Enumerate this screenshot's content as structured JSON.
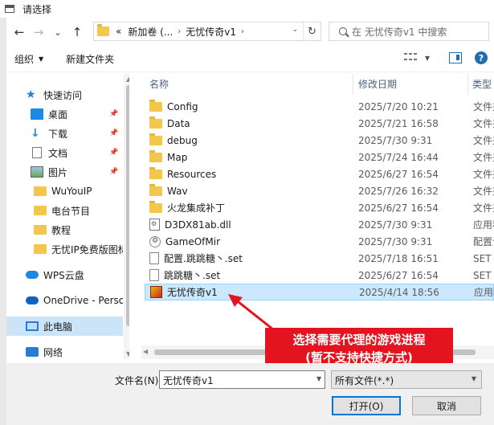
{
  "window": {
    "title": "请选择"
  },
  "nav": {
    "back_icon": "←",
    "forward_icon": "→",
    "dropdown_icon": "⌄",
    "up_icon": "↑",
    "breadcrumb": [
      "«",
      "新加卷 (...",
      "›",
      "无忧传奇v1",
      "›"
    ],
    "refresh_icon": "↻",
    "search_placeholder": "在 无忧传奇v1 中搜索"
  },
  "toolbar": {
    "organize_label": "组织",
    "organize_caret": "▼",
    "new_folder_label": "新建文件夹",
    "view_caret": "▼",
    "help_glyph": "?"
  },
  "sidebar": {
    "items": [
      {
        "label": "快速访问",
        "icon": "star-icon"
      },
      {
        "label": "桌面",
        "icon": "desktop-icon",
        "pin": "📌"
      },
      {
        "label": "下载",
        "icon": "download-icon",
        "pin": "📌"
      },
      {
        "label": "文档",
        "icon": "document-icon",
        "pin": "📌"
      },
      {
        "label": "图片",
        "icon": "pictures-icon",
        "pin": "📌"
      },
      {
        "label": "WuYouIP",
        "icon": "folder-icon"
      },
      {
        "label": "电台节目",
        "icon": "folder-icon"
      },
      {
        "label": "教程",
        "icon": "folder-icon"
      },
      {
        "label": "无忧IP免费版图标",
        "icon": "folder-icon"
      },
      {
        "label": "WPS云盘",
        "icon": "cloud-icon"
      },
      {
        "label": "OneDrive - Personal",
        "icon": "onedrive-icon"
      },
      {
        "label": "此电脑",
        "icon": "pc-icon"
      },
      {
        "label": "网络",
        "icon": "network-icon"
      }
    ]
  },
  "file_list": {
    "columns": {
      "name": "名称",
      "date": "修改日期",
      "type": "类型"
    },
    "sort_indicator": "⌃",
    "rows": [
      {
        "name": "Config",
        "date": "2025/7/20 10:21",
        "type": "文件夹",
        "icon": "folder-icon"
      },
      {
        "name": "Data",
        "date": "2025/7/21 16:58",
        "type": "文件夹",
        "icon": "folder-icon"
      },
      {
        "name": "debug",
        "date": "2025/7/30 9:31",
        "type": "文件夹",
        "icon": "folder-icon"
      },
      {
        "name": "Map",
        "date": "2025/7/24 16:44",
        "type": "文件夹",
        "icon": "folder-icon"
      },
      {
        "name": "Resources",
        "date": "2025/6/27 16:54",
        "type": "文件夹",
        "icon": "folder-icon"
      },
      {
        "name": "Wav",
        "date": "2025/7/26 16:32",
        "type": "文件夹",
        "icon": "folder-icon"
      },
      {
        "name": "火龙集成补丁",
        "date": "2025/6/27 16:54",
        "type": "文件夹",
        "icon": "folder-icon"
      },
      {
        "name": "D3DX81ab.dll",
        "date": "2025/7/30 9:31",
        "type": "应用程序扩展",
        "icon": "dll-icon"
      },
      {
        "name": "GameOfMir",
        "date": "2025/7/30 9:31",
        "type": "配置设置",
        "icon": "config-icon"
      },
      {
        "name": "配置.跳跳糖丶.set",
        "date": "2025/7/18 16:51",
        "type": "SET 文件",
        "icon": "file-icon"
      },
      {
        "name": "跳跳糖丶.set",
        "date": "2025/6/27 16:54",
        "type": "SET 文件",
        "icon": "file-icon"
      },
      {
        "name": "无忧传奇v1",
        "date": "2025/4/14 18:56",
        "type": "应用程序",
        "icon": "exe-icon",
        "selected": true
      }
    ]
  },
  "callout": {
    "line1": "选择需要代理的游戏进程",
    "line2": "(暂不支持快捷方式)",
    "color": "#e3131f"
  },
  "bottom": {
    "filename_label": "文件名(N):",
    "filename_value": "无忧传奇v1",
    "filetype_value": "所有文件(*.*)",
    "dropdown_caret": "▼",
    "open_label": "打开(O)",
    "cancel_label": "取消"
  },
  "colors": {
    "selection": "#cce8ff",
    "accent": "#0078d7",
    "folder": "#f3c64c"
  }
}
